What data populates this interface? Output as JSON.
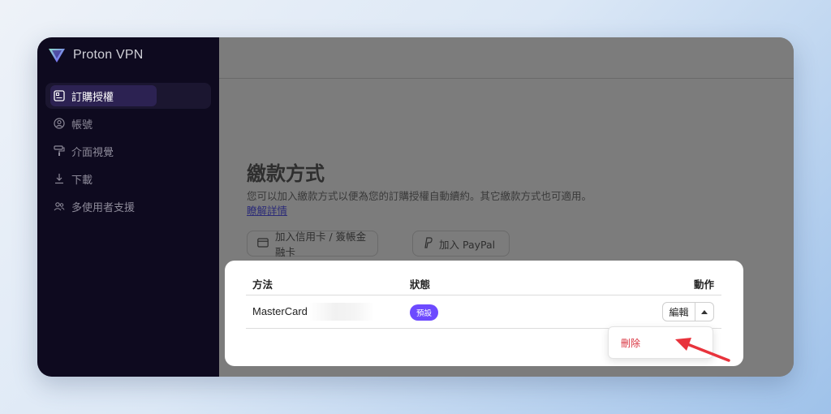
{
  "app": {
    "name": "Proton VPN"
  },
  "sidebar": {
    "items": [
      {
        "label": "訂購授權",
        "icon": "subscription-icon",
        "active": true
      },
      {
        "label": "帳號",
        "icon": "account-icon",
        "active": false
      },
      {
        "label": "介面視覺",
        "icon": "paint-roller-icon",
        "active": false
      },
      {
        "label": "下載",
        "icon": "download-icon",
        "active": false
      },
      {
        "label": "多使用者支援",
        "icon": "users-icon",
        "active": false
      }
    ]
  },
  "payment": {
    "title": "繳款方式",
    "description": "您可以加入繳款方式以便為您的訂購授權自動續約。其它繳款方式也可適用。",
    "learn_more": "瞭解詳情",
    "add_card_label": "加入信用卡 / 簽帳金融卡",
    "add_paypal_label": "加入 PayPal"
  },
  "table": {
    "headers": {
      "method": "方法",
      "status": "狀態",
      "actions": "動作"
    },
    "rows": [
      {
        "method": "MasterCard",
        "status": "預設",
        "edit_label": "編輯"
      }
    ]
  },
  "dropdown": {
    "delete_label": "刪除"
  },
  "colors": {
    "accent": "#6d4aff",
    "danger": "#d8333f",
    "annotation_arrow": "#e8333c",
    "sidebar_bg": "#0e0a1f"
  }
}
